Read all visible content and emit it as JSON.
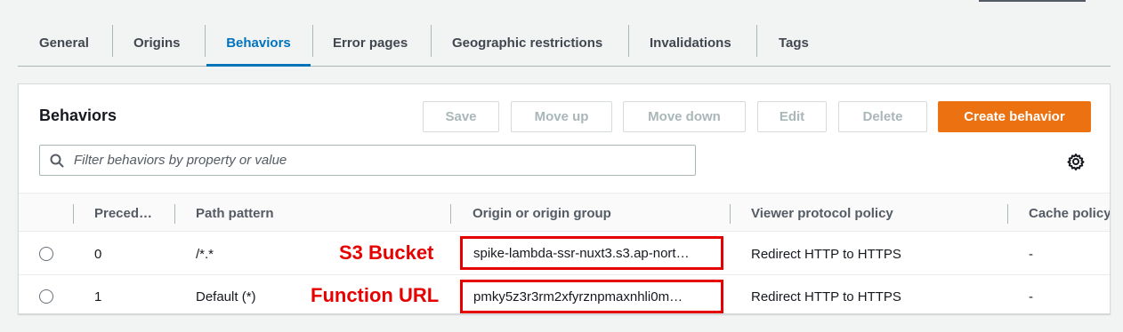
{
  "tabs": [
    {
      "label": "General"
    },
    {
      "label": "Origins"
    },
    {
      "label": "Behaviors",
      "active": true
    },
    {
      "label": "Error pages"
    },
    {
      "label": "Geographic restrictions"
    },
    {
      "label": "Invalidations"
    },
    {
      "label": "Tags"
    }
  ],
  "panel": {
    "title": "Behaviors",
    "buttons": {
      "save": "Save",
      "move_up": "Move up",
      "move_down": "Move down",
      "edit": "Edit",
      "delete": "Delete",
      "create": "Create behavior"
    },
    "search_placeholder": "Filter behaviors by property or value"
  },
  "table": {
    "columns": [
      "Preced…",
      "Path pattern",
      "Origin or origin group",
      "Viewer protocol policy",
      "Cache policy"
    ],
    "rows": [
      {
        "precedence": "0",
        "path": "/*.*",
        "annotation": "S3 Bucket",
        "origin": "spike-lambda-ssr-nuxt3.s3.ap-nort…",
        "viewer_policy": "Redirect HTTP to HTTPS",
        "cache_policy": "-"
      },
      {
        "precedence": "1",
        "path": "Default (*)",
        "annotation": "Function URL",
        "origin": "pmky5z3r3rm2xfyrznpmaxnhli0m…",
        "viewer_policy": "Redirect HTTP to HTTPS",
        "cache_policy": "-"
      }
    ]
  },
  "colors": {
    "accent": "#0073bb",
    "primary_button": "#ec7211",
    "annotation": "#e60000"
  },
  "icons": {
    "search": "search-icon",
    "settings": "gear-icon"
  }
}
